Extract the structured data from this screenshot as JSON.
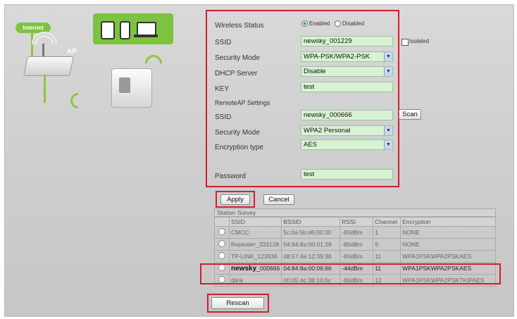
{
  "illustration": {
    "internet_label": "Internet",
    "ap_label": "AP"
  },
  "form": {
    "wireless_status": {
      "label": "Wireless Status",
      "options": [
        "Enabled",
        "Disabled"
      ],
      "selected": "Enabled"
    },
    "ssid": {
      "label": "SSID",
      "value": "newsky_001229",
      "isolated_label": "Isolated",
      "isolated_checked": false
    },
    "security_mode": {
      "label": "Security Mode",
      "value": "WPA-PSK/WPA2-PSK"
    },
    "dhcp_server": {
      "label": "DHCP Server",
      "value": "Disable"
    },
    "key": {
      "label": "KEY",
      "value": "test"
    },
    "remote_ap_heading": "RemoteAP Settings",
    "remote_ssid": {
      "label": "SSID",
      "value": "newsky_000666",
      "scan_label": "Scan"
    },
    "remote_security_mode": {
      "label": "Security Mode",
      "value": "WPA2 Personal"
    },
    "encryption_type": {
      "label": "Encryption type",
      "value": "AES"
    },
    "password": {
      "label": "Password",
      "value": "test"
    }
  },
  "buttons": {
    "apply": "Apply",
    "cancel": "Cancel",
    "rescan": "Rescan"
  },
  "survey": {
    "title": "Station Survey",
    "columns": [
      "SSID",
      "BSSID",
      "RSSI",
      "Channel",
      "Encryption"
    ],
    "rows": [
      {
        "ssid": "CMCC",
        "ssid_suffix": "",
        "bssid": "5c:0a:5b:d6:00:30",
        "rssi": "-80dBm",
        "channel": "1",
        "encryption": "NONE",
        "highlight": false
      },
      {
        "ssid": "Repeater_333128",
        "ssid_suffix": "",
        "bssid": "04:84:8a:00:01:28",
        "rssi": "-80dBm",
        "channel": "6",
        "encryption": "NONE",
        "highlight": false
      },
      {
        "ssid": "TP-LINK_123936",
        "ssid_suffix": "",
        "bssid": "d8:57:4e:12:39:36",
        "rssi": "-80dBm",
        "channel": "11",
        "encryption": "WPA1PSKWPA2PSKAES",
        "highlight": false
      },
      {
        "ssid": "newsky",
        "ssid_suffix": "_000666",
        "bssid": "04:84:8a:00:06:66",
        "rssi": "-44dBm",
        "channel": "11",
        "encryption": "WPA1PSKWPA2PSKAES",
        "highlight": true
      },
      {
        "ssid": "dlink",
        "ssid_suffix": "",
        "bssid": "00:05:4c:38:10:6c",
        "rssi": "-80dBm",
        "channel": "12",
        "encryption": "WPA1PSKWPA2PSKTKIPAES",
        "highlight": false
      }
    ]
  },
  "colors": {
    "accent_green": "#7ec242",
    "field_green": "#d9f2d4",
    "highlight_red": "#d11e2d"
  }
}
